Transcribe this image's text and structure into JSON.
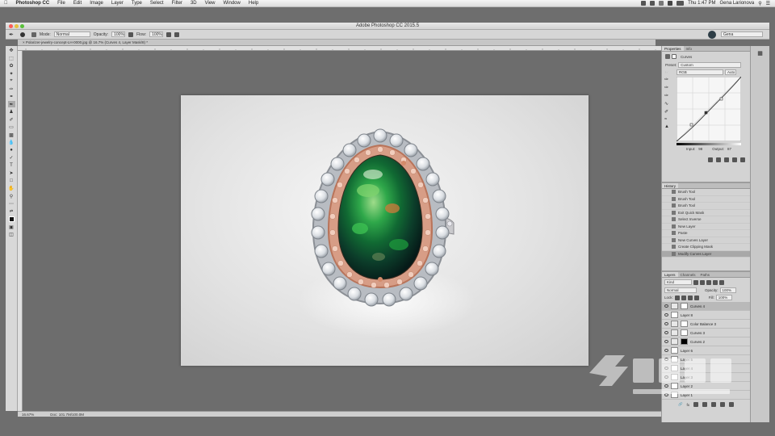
{
  "menubar": {
    "app_name": "Photoshop CC",
    "items": [
      "File",
      "Edit",
      "Image",
      "Layer",
      "Type",
      "Select",
      "Filter",
      "3D",
      "View",
      "Window",
      "Help"
    ],
    "clock": "Thu 1:47 PM",
    "user": "Gena Larionova"
  },
  "window": {
    "title": "Adobe Photoshop CC 2015.5"
  },
  "options_bar": {
    "mode_label": "Mode:",
    "mode_value": "Normal",
    "opacity_label": "Opacity:",
    "opacity_value": "100%",
    "flow_label": "Flow:",
    "flow_value": "100%",
    "workspace": "Gena"
  },
  "document": {
    "tab_title": "Polarizer-jewelry-concept-LH-0000.jpg @ 16.7% (Curves 4, Layer Mask/8) *",
    "zoom": "16.67%",
    "doc_info": "Doc: 101.7M/100.0M"
  },
  "properties": {
    "tabs": [
      "Properties",
      "Info"
    ],
    "panel_title": "Curves",
    "preset_label": "Preset:",
    "preset_value": "Custom",
    "channel_value": "RGB",
    "auto_label": "Auto",
    "input_label": "Input:",
    "input_value": "98",
    "output_label": "Output:",
    "output_value": "87"
  },
  "history": {
    "tab": "History",
    "items": [
      "Brush Tool",
      "Brush Tool",
      "Brush Tool",
      "Exit Quick Mask",
      "Select Inverse",
      "New Layer",
      "Paste",
      "New Curves Layer",
      "Create Clipping Mask",
      "Modify Curves Layer"
    ]
  },
  "layers": {
    "tabs": [
      "Layers",
      "Channels",
      "Paths"
    ],
    "kind_label": "Kind",
    "blend_mode": "Normal",
    "opacity_label": "Opacity:",
    "opacity_value": "100%",
    "lock_label": "Lock:",
    "fill_label": "Fill:",
    "fill_value": "100%",
    "items": [
      "Curves 4",
      "Layer 8",
      "Color Balance 3",
      "Curves 3",
      "Curves 2",
      "Layer 6",
      "Layer 5",
      "Layer 4",
      "Layer 3",
      "Layer 2",
      "Layer 1"
    ]
  },
  "colors": {
    "accent": "#2a8ad4",
    "gem_green": "#1f8f3a",
    "rose_gold": "#c98a6e"
  }
}
